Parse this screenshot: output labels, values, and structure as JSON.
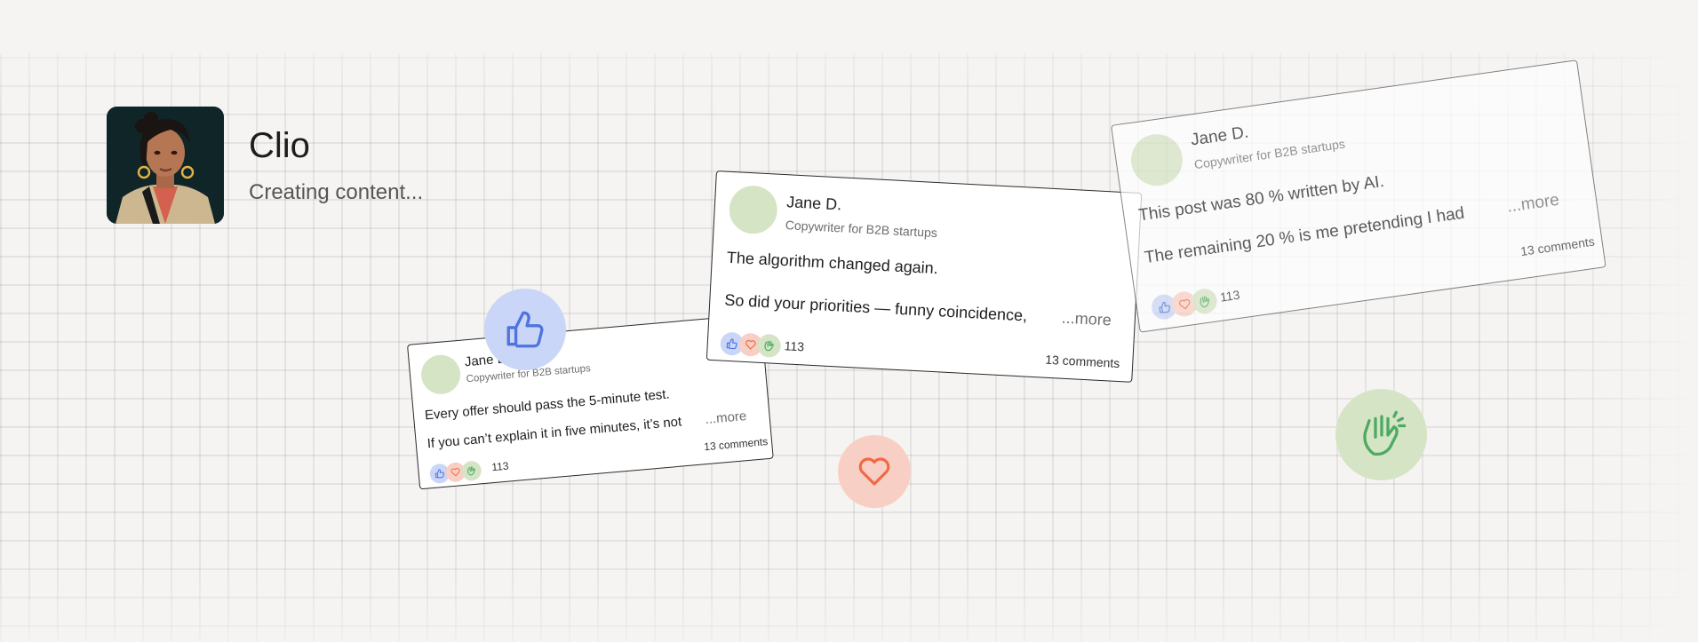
{
  "profile": {
    "name": "Clio",
    "status": "Creating content..."
  },
  "posts": [
    {
      "author": "Jane D.",
      "role": "Copywriter for B2B startups",
      "line1": "Every offer should pass the 5-minute test.",
      "line2": "If you can’t explain it in five minutes, it’s not",
      "more": "...more",
      "reaction_count": "113",
      "comments": "13 comments"
    },
    {
      "author": "Jane D.",
      "role": "Copywriter for B2B startups",
      "line1": "The algorithm changed again.",
      "line2": "So did your priorities — funny coincidence,",
      "more": "...more",
      "reaction_count": "113",
      "comments": "13 comments"
    },
    {
      "author": "Jane D.",
      "role": "Copywriter for B2B startups",
      "line1": "This post was 80 % written by AI.",
      "line2": "The remaining 20 % is me pretending I had",
      "more": "...more",
      "reaction_count": "113",
      "comments": "13 comments"
    }
  ],
  "icons": {
    "like": "thumbs-up-icon",
    "love": "heart-icon",
    "clap": "clapping-hands-icon"
  },
  "colors": {
    "like": "#4f73e0",
    "love": "#ef6a45",
    "clap": "#4caa62",
    "like_bg": "#c9d6f7",
    "love_bg": "#f8cfc4",
    "clap_bg": "#d5e4c5"
  }
}
